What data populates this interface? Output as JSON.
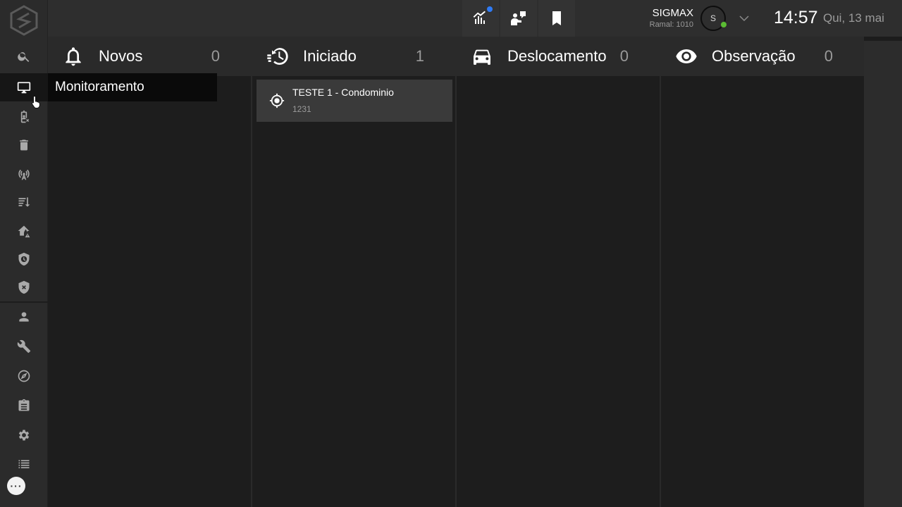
{
  "sidebar": {
    "logo": "sigmax-logo",
    "items": [
      {
        "name": "search",
        "icon": "search-icon"
      },
      {
        "name": "monitoramento",
        "icon": "monitor-icon",
        "active": true
      },
      {
        "name": "badge-remove",
        "icon": "badge-remove-icon"
      },
      {
        "name": "trash",
        "icon": "trash-icon"
      },
      {
        "name": "antenna",
        "icon": "antenna-icon"
      },
      {
        "name": "sort",
        "icon": "sort-icon"
      },
      {
        "name": "home-alert",
        "icon": "home-alert-icon"
      },
      {
        "name": "shield-clock",
        "icon": "shield-clock-icon"
      },
      {
        "name": "shield-x",
        "icon": "shield-x-icon"
      },
      {
        "name": "user",
        "icon": "user-icon"
      },
      {
        "name": "wrench",
        "icon": "wrench-icon"
      },
      {
        "name": "compass",
        "icon": "compass-icon"
      },
      {
        "name": "clipboard",
        "icon": "clipboard-icon"
      },
      {
        "name": "settings",
        "icon": "gear-icon"
      },
      {
        "name": "list",
        "icon": "list-icon"
      }
    ],
    "chat_icon": "chat-dots-icon"
  },
  "tooltip": {
    "label": "Monitoramento"
  },
  "topbar": {
    "icons": [
      "chart-icon",
      "transfer-icon",
      "bookmark-icon"
    ],
    "user_name": "SIGMAX",
    "user_ext": "Ramal: 1010",
    "avatar_initial": "S",
    "time": "14:57",
    "date": "Qui, 13 mai"
  },
  "columns": [
    {
      "title": "Novos",
      "count": "0",
      "icon": "bell-icon"
    },
    {
      "title": "Iniciado",
      "count": "1",
      "icon": "history-icon",
      "cards": [
        {
          "title": "TESTE 1 - Condominio",
          "code": "1231",
          "icon": "crosshair-icon"
        }
      ]
    },
    {
      "title": "Deslocamento",
      "count": "0",
      "icon": "car-icon"
    },
    {
      "title": "Observação",
      "count": "0",
      "icon": "eye-icon"
    }
  ],
  "colors": {
    "accent_dot": "#2f7bf5",
    "online": "#5bbd33"
  }
}
